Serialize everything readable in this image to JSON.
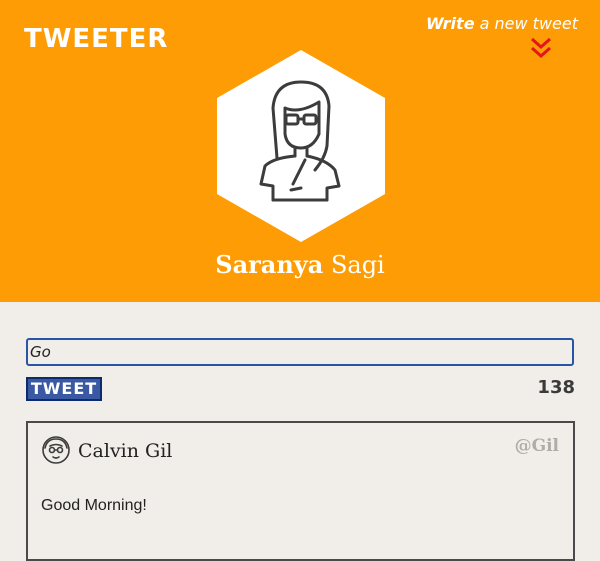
{
  "header": {
    "logo": "TWEETER",
    "write_link": {
      "bold": "Write",
      "rest": " a new tweet"
    },
    "background_color": "#fd9c04",
    "chevron_icon": "double-chevron-down-icon",
    "chevron_color": "#e5161b"
  },
  "profile": {
    "first_name": "Saranya",
    "last_name": "Sagi",
    "avatar_icon": "woman-avatar-icon"
  },
  "composer": {
    "input_value": "Go",
    "button_label": "TWEET",
    "chars_left": "138",
    "button_color": "#3b59a3"
  },
  "tweets": [
    {
      "name": "Calvin Gil",
      "handle": "@Gil",
      "text": "Good Morning!",
      "avatar_icon": "man-avatar-icon"
    }
  ]
}
